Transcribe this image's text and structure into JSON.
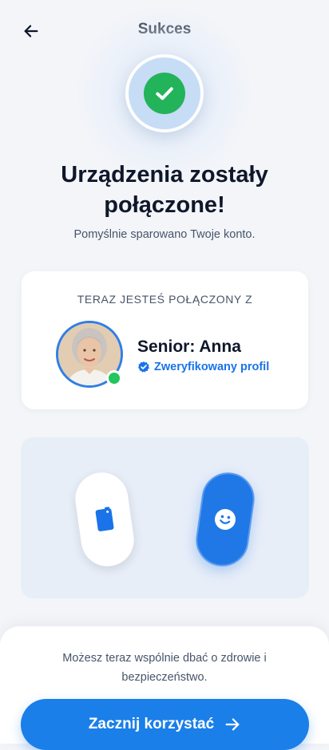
{
  "header": {
    "title": "Sukces",
    "back_icon": "arrow-left-icon"
  },
  "success": {
    "icon": "check-circle-icon",
    "title": "Urządzenia zostały połączone!",
    "subtitle": "Pomyślnie sparowano Twoje konto."
  },
  "connection_card": {
    "label": "TERAZ JESTEŚ POŁĄCZONY Z",
    "name": "Senior: Anna",
    "verified_label": "Zweryfikowany profil",
    "online_status_color": "#22c55e"
  },
  "devices": {
    "left_device_icon": "phone-tag-icon",
    "right_device_icon": "smiley-icon"
  },
  "bottom": {
    "message": "Możesz teraz wspólnie dbać o zdrowie i bezpieczeństwo.",
    "cta_label": "Zacznij korzystać",
    "cta_icon": "arrow-right-icon"
  },
  "colors": {
    "accent": "#1a7fe8",
    "success": "#23b35a",
    "background": "#f3f5f9"
  }
}
